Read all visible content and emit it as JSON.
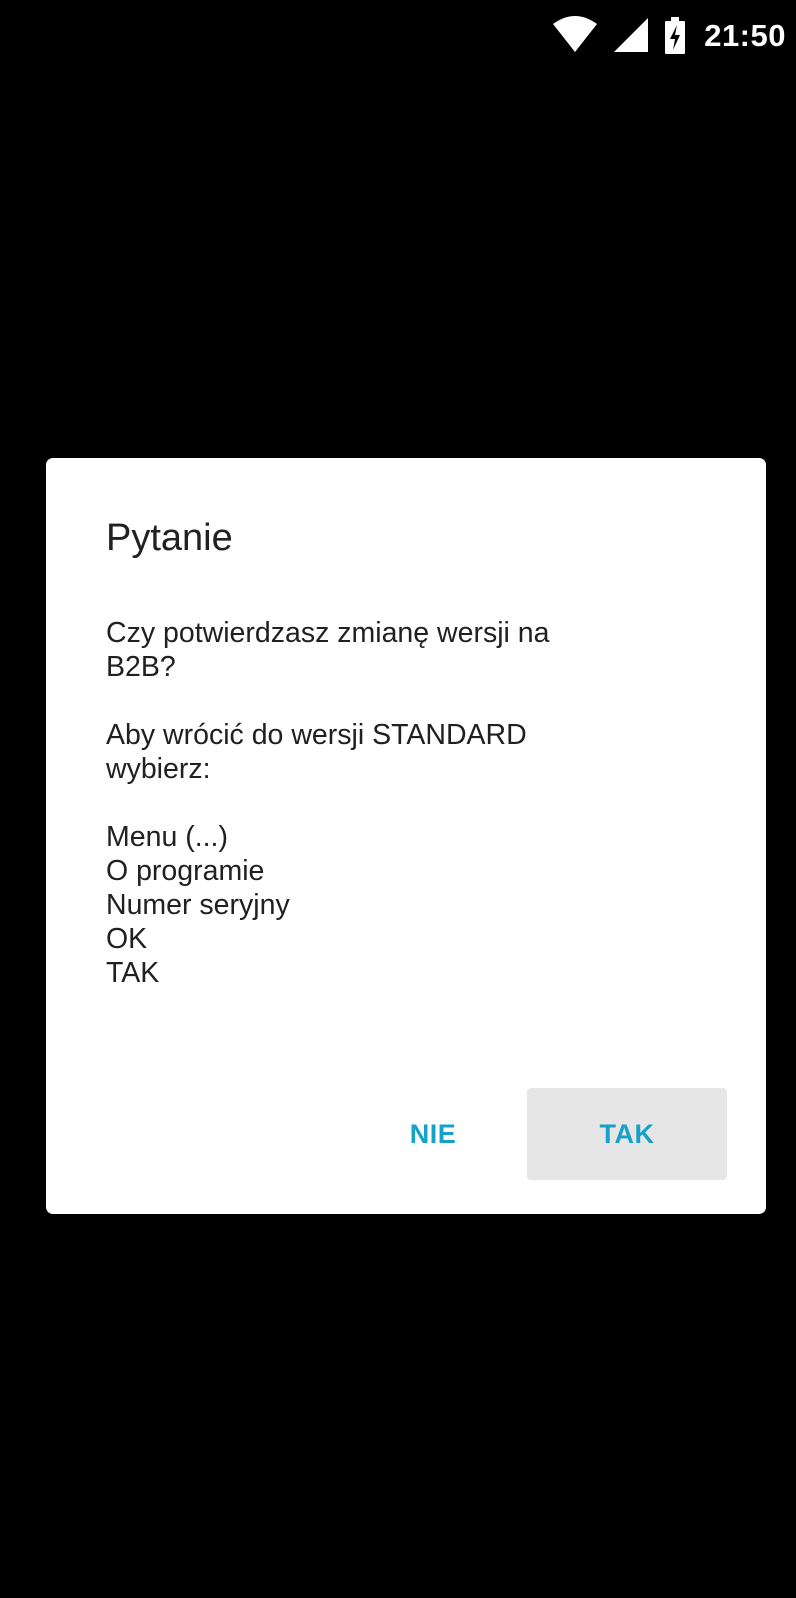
{
  "status_bar": {
    "time": "21:50",
    "icons": [
      "wifi-icon",
      "cell-signal-icon",
      "battery-charging-icon"
    ],
    "icon_color": "#ffffff"
  },
  "dialog": {
    "title": "Pytanie",
    "message": {
      "question_line1": "Czy potwierdzasz zmianę wersji na",
      "question_line2": "B2B?",
      "instruction_line1": "Aby wrócić do wersji STANDARD",
      "instruction_line2": "wybierz:",
      "steps": [
        "Menu (...)",
        "O programie",
        "Numer seryjny",
        "OK",
        "TAK"
      ]
    },
    "buttons": {
      "negative_label": "NIE",
      "positive_label": "TAK"
    },
    "accent_color": "#16a2c8",
    "background_color": "#ffffff"
  },
  "background_color": "#000000"
}
